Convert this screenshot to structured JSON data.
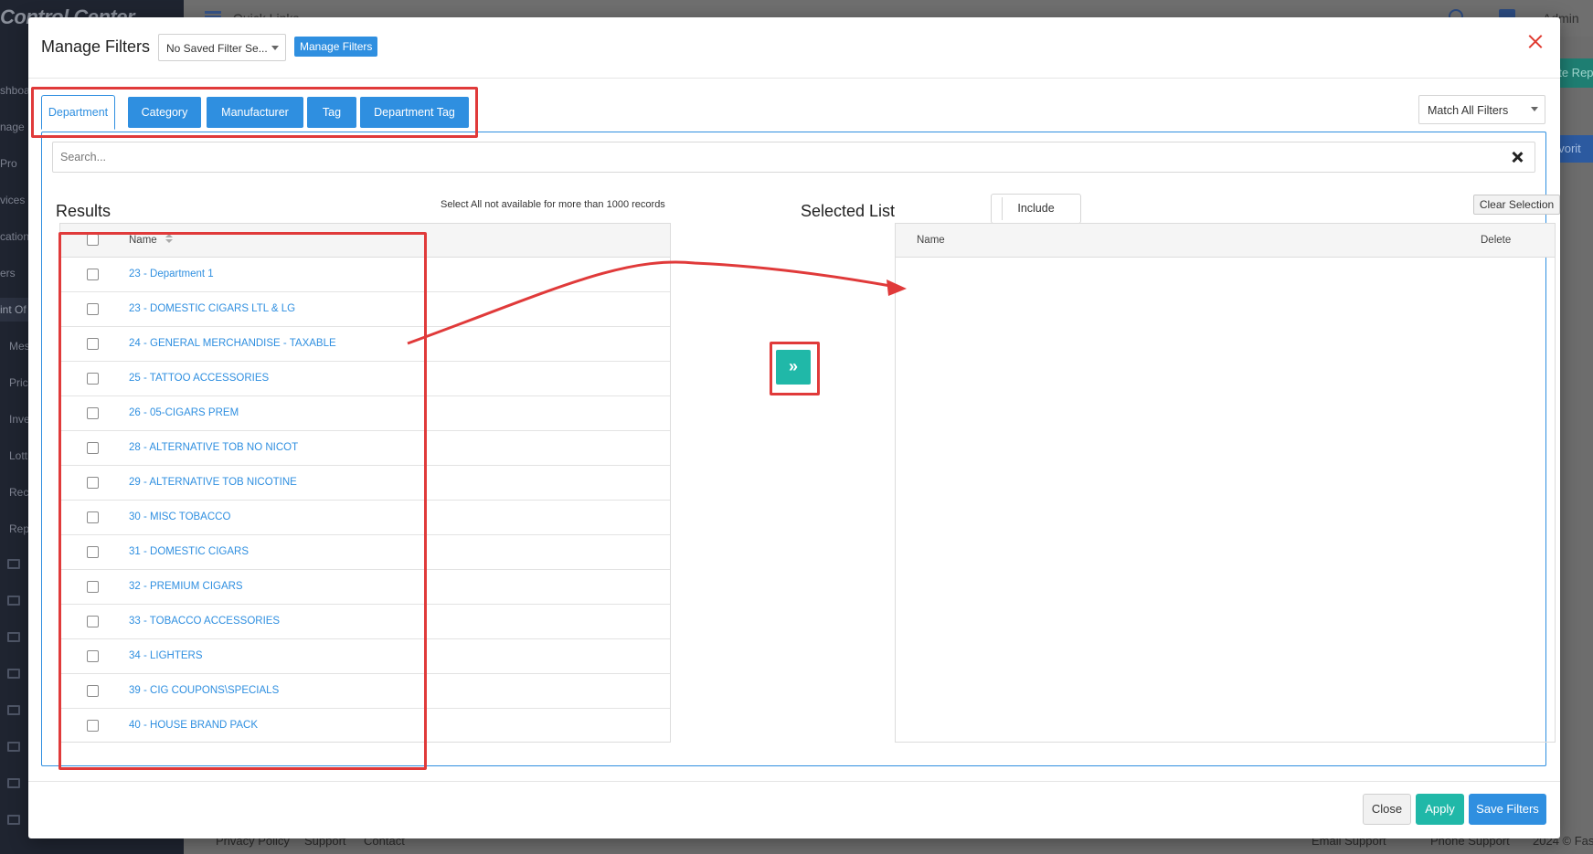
{
  "background": {
    "brand": "Control Center",
    "sidebar_items": [
      "shboa",
      "nage",
      "Pro",
      "vices",
      "cation",
      "ers",
      "int Of",
      "Mes",
      "Pric",
      "Inve",
      "Lott",
      "Rec",
      "Rep"
    ],
    "topbar": {
      "quick_links": "Quick Links",
      "user": "Admin"
    },
    "side_buttons": {
      "teal": "ate Rep",
      "blue": "avorit"
    },
    "footer": {
      "privacy": "Privacy Policy",
      "support": "Support",
      "contact": "Contact",
      "email_support": "Email Support",
      "phone_support": "Phone Support",
      "copyright": "2024 © Fas"
    }
  },
  "modal": {
    "title": "Manage Filters",
    "saved_filter_select": "No Saved Filter Se...",
    "manage_filters_button": "Manage Filters",
    "tabs": [
      {
        "label": "Department",
        "active": true
      },
      {
        "label": "Category",
        "active": false
      },
      {
        "label": "Manufacturer",
        "active": false
      },
      {
        "label": "Tag",
        "active": false
      },
      {
        "label": "Department Tag",
        "active": false
      }
    ],
    "match_select": "Match All Filters",
    "search": {
      "placeholder": "Search...",
      "value": ""
    },
    "results": {
      "title": "Results",
      "note": "Select All not available for more than 1000 records",
      "column_name": "Name",
      "rows": [
        "23 - Department 1",
        "23 - DOMESTIC CIGARS LTL & LG",
        "24 - GENERAL MERCHANDISE - TAXABLE",
        "25 - TATTOO ACCESSORIES",
        "26 - 05-CIGARS PREM",
        "28 - ALTERNATIVE TOB NO NICOT",
        "29 - ALTERNATIVE TOB NICOTINE",
        "30 - MISC TOBACCO",
        "31 - DOMESTIC CIGARS",
        "32 - PREMIUM CIGARS",
        "33 - TOBACCO ACCESSORIES",
        "34 - LIGHTERS",
        "39 - CIG COUPONS\\SPECIALS",
        "40 - HOUSE BRAND PACK"
      ]
    },
    "move_button_glyph": "»",
    "selected": {
      "title": "Selected List",
      "include_toggle": "Include",
      "clear_button": "Clear Selection",
      "column_name": "Name",
      "column_delete": "Delete"
    },
    "footer": {
      "close": "Close",
      "apply": "Apply",
      "save": "Save Filters"
    }
  },
  "colors": {
    "primary": "#2f8fe0",
    "teal": "#20b8a8",
    "annotation": "#e03a3a",
    "close_icon": "#e0392f"
  }
}
